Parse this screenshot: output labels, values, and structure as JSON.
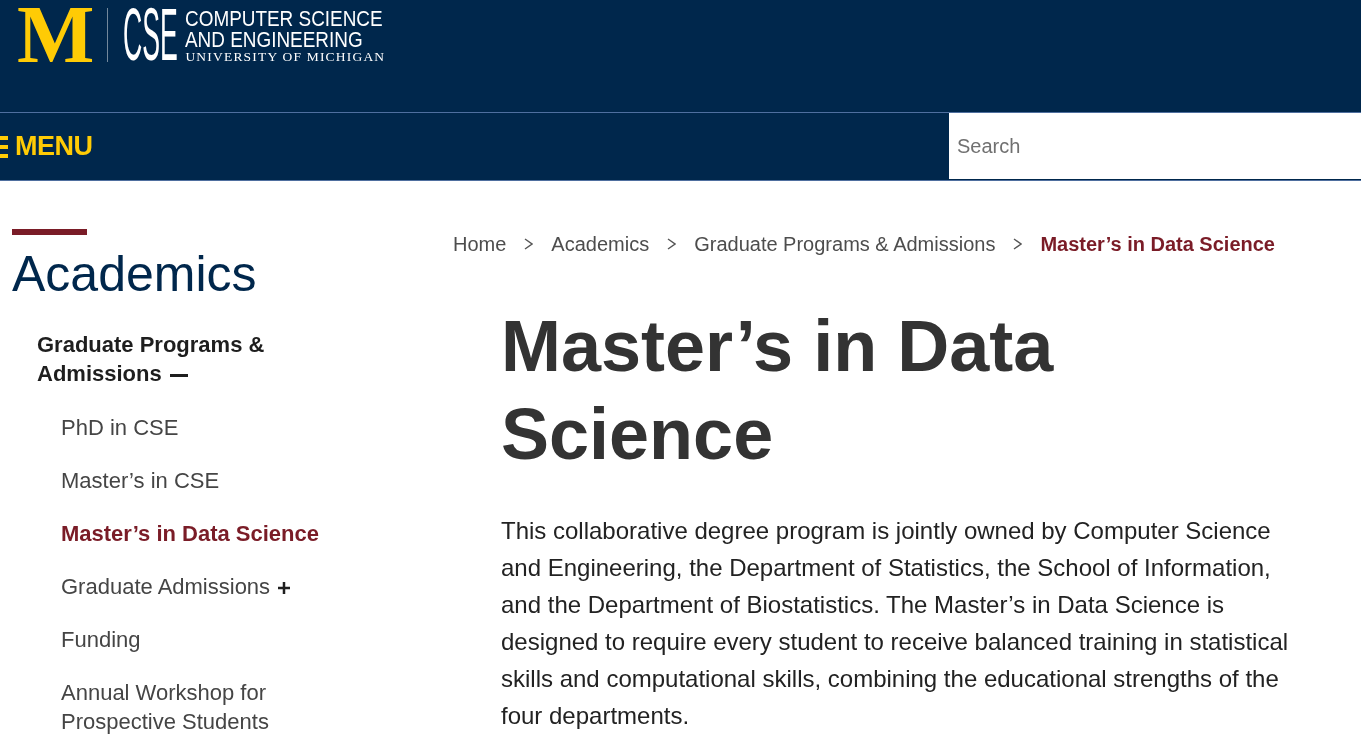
{
  "header": {
    "logo": {
      "mark": "M",
      "acronym": "CSE",
      "department": [
        "COMPUTER SCIENCE",
        "AND ENGINEERING"
      ],
      "university": "UNIVERSITY OF MICHIGAN"
    }
  },
  "nav_bar": {
    "menu_label": "MENU",
    "search": {
      "placeholder": "Search"
    }
  },
  "sidebar": {
    "title": "Academics",
    "section": {
      "label": "Graduate Programs & Admissions",
      "expanded": true,
      "children": [
        {
          "label": "PhD in CSE",
          "kind": "link",
          "selected": false
        },
        {
          "label": "Master’s in CSE",
          "kind": "link",
          "selected": false
        },
        {
          "label": "Master’s in Data Science",
          "kind": "link",
          "selected": true
        },
        {
          "label": "Graduate Admissions",
          "kind": "group",
          "selected": false,
          "expanded": false
        },
        {
          "label": "Funding",
          "kind": "link",
          "selected": false
        },
        {
          "label": "Annual Workshop for Prospective Students",
          "kind": "link",
          "selected": false
        }
      ]
    }
  },
  "breadcrumb": [
    {
      "label": "Home",
      "current": false
    },
    {
      "label": "Academics",
      "current": false
    },
    {
      "label": "Graduate Programs & Admissions",
      "current": false
    },
    {
      "label": "Master’s in Data Science",
      "current": true
    }
  ],
  "article": {
    "title": "Master’s in Data Science",
    "body": "This collaborative degree program is jointly owned by Computer Science and Engineering, the Department of Statistics, the School of Information, and the Department of Biostatistics. The Master’s in Data Science is designed to require every student to receive balanced training in statistical skills and computational skills, combining the educational strengths of the four departments."
  }
}
